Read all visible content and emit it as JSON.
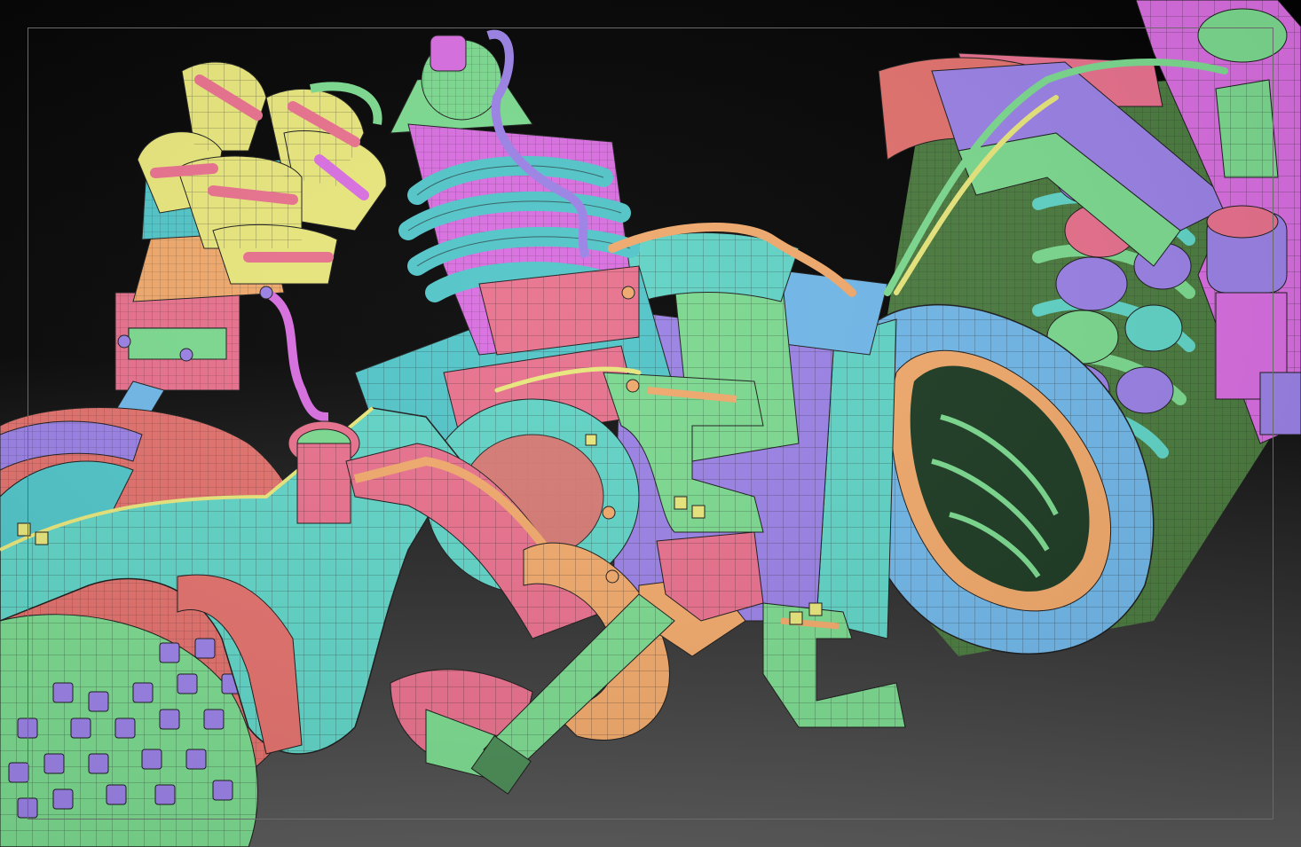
{
  "viewport": {
    "background_top": "#000000",
    "background_bottom": "#5a5a5a",
    "frame_color": "#6a6a6a"
  },
  "model": {
    "render_style": "polygroup-colored mechanical hard-surface model with wireframe overlay",
    "palette": [
      "#5fd3c6",
      "#e86f8c",
      "#9a80e6",
      "#7ad98e",
      "#f0a86a",
      "#e8e67a",
      "#6fb6e8",
      "#e2706c",
      "#d86ce0",
      "#4fc4c8"
    ],
    "wire_color": "#1a1a1a"
  }
}
